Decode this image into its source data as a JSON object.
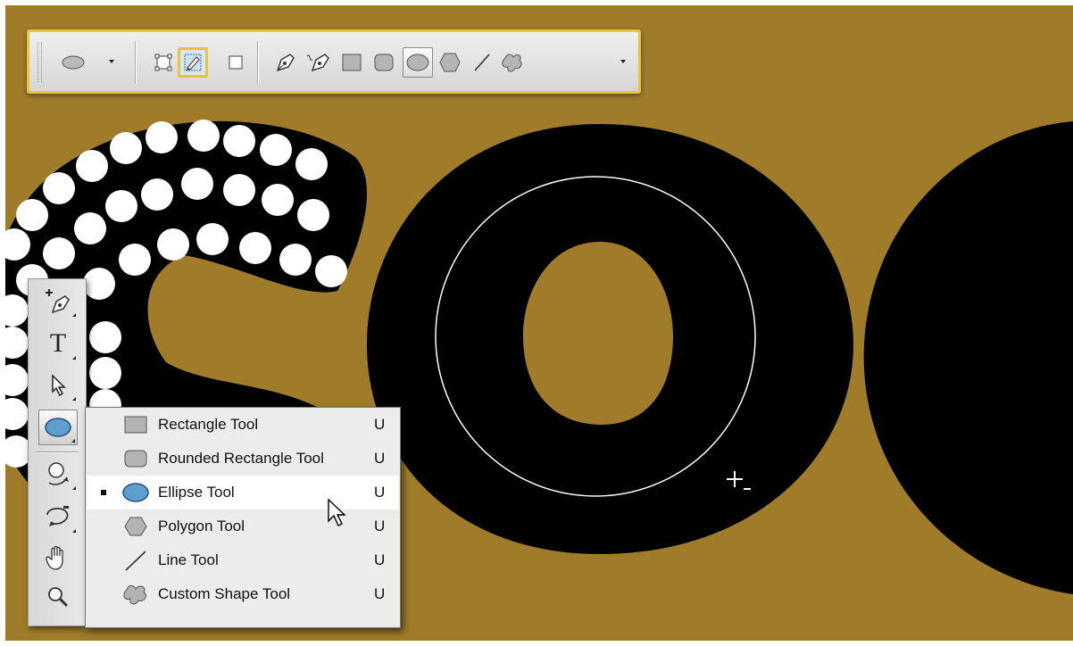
{
  "options_bar": {
    "tool_preset_icon": "ellipse-preset-icon",
    "mode_buttons": [
      {
        "name": "shape-layers-icon",
        "active": false
      },
      {
        "name": "paths-icon",
        "active": true
      },
      {
        "name": "fill-pixels-icon",
        "active": false
      }
    ],
    "shape_buttons": [
      {
        "name": "pen-icon"
      },
      {
        "name": "freeform-pen-icon"
      },
      {
        "name": "rectangle-icon"
      },
      {
        "name": "rounded-rectangle-icon"
      },
      {
        "name": "ellipse-icon",
        "active": true
      },
      {
        "name": "polygon-icon"
      },
      {
        "name": "line-icon"
      },
      {
        "name": "custom-shape-icon"
      }
    ],
    "highlight_color": "#e8c43a"
  },
  "tools_panel": {
    "tools": [
      {
        "name": "pen-tool-icon"
      },
      {
        "name": "type-tool-icon",
        "glyph": "T"
      },
      {
        "name": "path-selection-icon"
      },
      {
        "name": "ellipse-tool-icon",
        "active": true
      },
      {
        "name": "3d-rotate-icon"
      },
      {
        "name": "3d-orbit-icon"
      },
      {
        "name": "hand-tool-icon"
      },
      {
        "name": "zoom-tool-icon"
      }
    ]
  },
  "flyout_menu": {
    "items": [
      {
        "label": "Rectangle Tool",
        "shortcut": "U",
        "icon": "rectangle-icon",
        "selected": false
      },
      {
        "label": "Rounded Rectangle Tool",
        "shortcut": "U",
        "icon": "rounded-rectangle-icon",
        "selected": false
      },
      {
        "label": "Ellipse Tool",
        "shortcut": "U",
        "icon": "ellipse-icon",
        "selected": true
      },
      {
        "label": "Polygon Tool",
        "shortcut": "U",
        "icon": "polygon-icon",
        "selected": false
      },
      {
        "label": "Line Tool",
        "shortcut": "U",
        "icon": "line-icon",
        "selected": false
      },
      {
        "label": "Custom Shape Tool",
        "shortcut": "U",
        "icon": "custom-shape-icon",
        "selected": false
      }
    ]
  },
  "canvas": {
    "background_color": "#a07c2a",
    "letter_color": "#000000",
    "dot_color": "#ffffff"
  },
  "cursors": {
    "pointer": "arrow-cursor-icon",
    "crosshair": "crosshair-minus-cursor-icon"
  }
}
